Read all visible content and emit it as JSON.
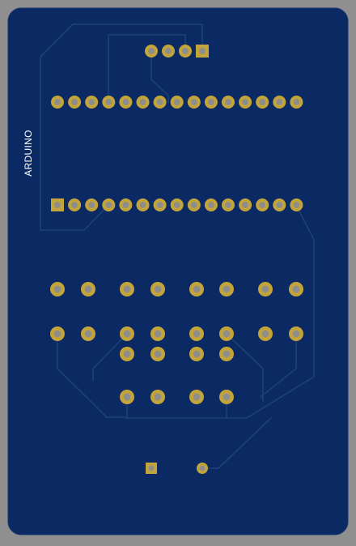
{
  "colors": {
    "background": "#8f8f8f",
    "board": "#0b2a63",
    "board_edge": "#123372",
    "trace": "#1f3f78",
    "pad": "#c2a43a",
    "pad_hole": "#8d8d8d",
    "silkscreen": "#ffffff"
  },
  "board": {
    "silkscreen_label": "ARDUINO"
  },
  "pads": {
    "header_4pin_count": 4,
    "upper_row_count": 15,
    "lower_row_count": 15,
    "button_grid_count": 24,
    "power_connector_count": 2
  }
}
